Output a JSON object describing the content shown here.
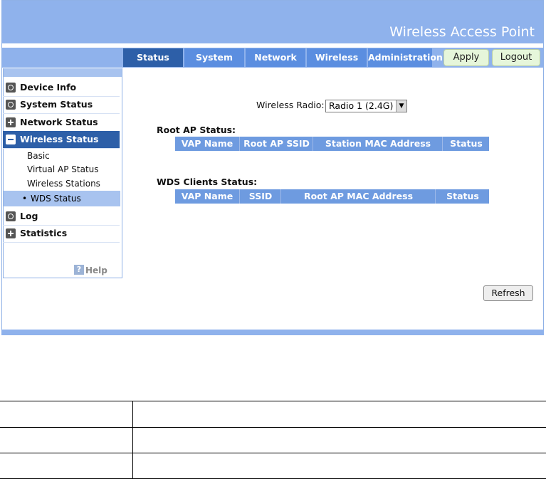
{
  "app": {
    "title": "Wireless Access Point"
  },
  "nav": {
    "tabs": [
      {
        "label": "Status",
        "active": true
      },
      {
        "label": "System"
      },
      {
        "label": "Network"
      },
      {
        "label": "Wireless"
      },
      {
        "label": "Administration"
      }
    ],
    "apply_label": "Apply",
    "logout_label": "Logout"
  },
  "sidebar": {
    "items": [
      {
        "label": "Device Info",
        "icon": "circle-icon"
      },
      {
        "label": "System Status",
        "icon": "circle-icon"
      },
      {
        "label": "Network Status",
        "icon": "plus-icon"
      },
      {
        "label": "Wireless Status",
        "icon": "minus-icon",
        "active": true
      },
      {
        "label": "Log",
        "icon": "circle-icon"
      },
      {
        "label": "Statistics",
        "icon": "plus-icon"
      }
    ],
    "subitems": [
      {
        "label": "Basic"
      },
      {
        "label": "Virtual AP Status"
      },
      {
        "label": "Wireless Stations"
      },
      {
        "label": "WDS Status",
        "active": true
      }
    ],
    "help_label": "Help",
    "help_icon_glyph": "?"
  },
  "main": {
    "radio_label": "Wireless Radio:",
    "radio_value": "Radio 1 (2.4G)",
    "root_ap": {
      "title": "Root AP Status:",
      "columns": [
        "VAP Name",
        "Root AP SSID",
        "Station MAC Address",
        "Status"
      ]
    },
    "wds_clients": {
      "title": "WDS Clients Status:",
      "columns": [
        "VAP Name",
        "SSID",
        "Root AP MAC Address",
        "Status"
      ]
    },
    "refresh_label": "Refresh"
  },
  "colors": {
    "banner": "#8fb2ec",
    "tab": "#5b8ee0",
    "tab_active": "#2d5fa8",
    "table_header": "#6e9be0",
    "button_green": "#e6f6da"
  }
}
